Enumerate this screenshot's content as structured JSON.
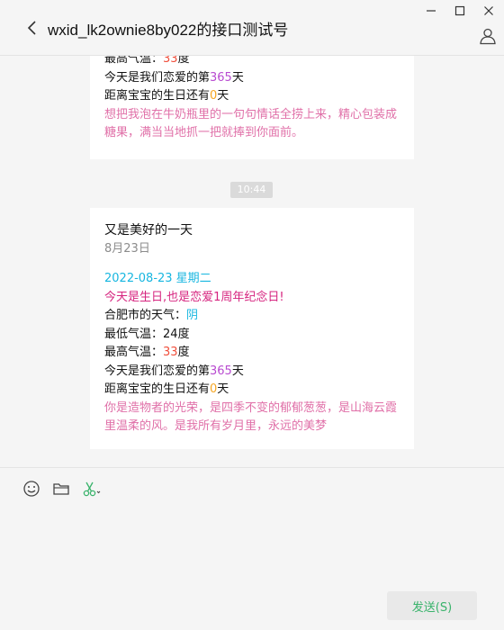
{
  "window": {
    "minimize_glyph": "—",
    "maximize_glyph": "☐",
    "close_glyph": "✕"
  },
  "header": {
    "title": "wxid_lk2ownie8by022的接口测试号"
  },
  "messages": [
    {
      "lines_top": [
        {
          "prefix": "最高气温：",
          "value": "33",
          "suffix": "度",
          "value_color": "#f04f3c"
        },
        {
          "prefix": "今天是我们恋爱的第",
          "value": "365",
          "suffix": "天",
          "value_color": "#b84bd0"
        },
        {
          "prefix": "距离宝宝的生日还有",
          "value": "0",
          "suffix": "天",
          "value_color": "#f5a623"
        }
      ],
      "quote": "想把我泡在牛奶瓶里的一句句情话全捞上来，精心包装成糖果，满当当地抓一把就捧到你面前。"
    },
    {
      "timestamp": "10:44",
      "title": "又是美好的一天",
      "date_sub": "8月23日",
      "date_line": "2022-08-23  星期二",
      "birthday_line": "今天是生日,也是恋爱1周年纪念日!",
      "weather_prefix": "合肥市的天气：",
      "weather_value": "阴",
      "min_temp_prefix": "最低气温：",
      "min_temp_value": "24",
      "min_temp_suffix": "度",
      "max_temp_prefix": "最高气温：",
      "max_temp_value": "33",
      "max_temp_suffix": "度",
      "love_prefix": "今天是我们恋爱的第",
      "love_value": "365",
      "love_suffix": "天",
      "bday_prefix": "距离宝宝的生日还有",
      "bday_value": "0",
      "bday_suffix": "天",
      "quote": "你是造物者的光荣，是四季不变的郁郁葱葱，是山海云霞里温柔的风。是我所有岁月里，永远的美梦"
    }
  ],
  "input": {
    "send_label": "发送(S)",
    "tools": [
      "emoji-icon",
      "folder-icon",
      "scissors-icon"
    ]
  },
  "colors": {
    "accent_green": "#39b36b",
    "pink": "#e070a8",
    "red": "#f04f3c",
    "purple": "#b84bd0",
    "orange": "#f5a623",
    "teal": "#17b6e0",
    "magenta": "#d6247f"
  }
}
